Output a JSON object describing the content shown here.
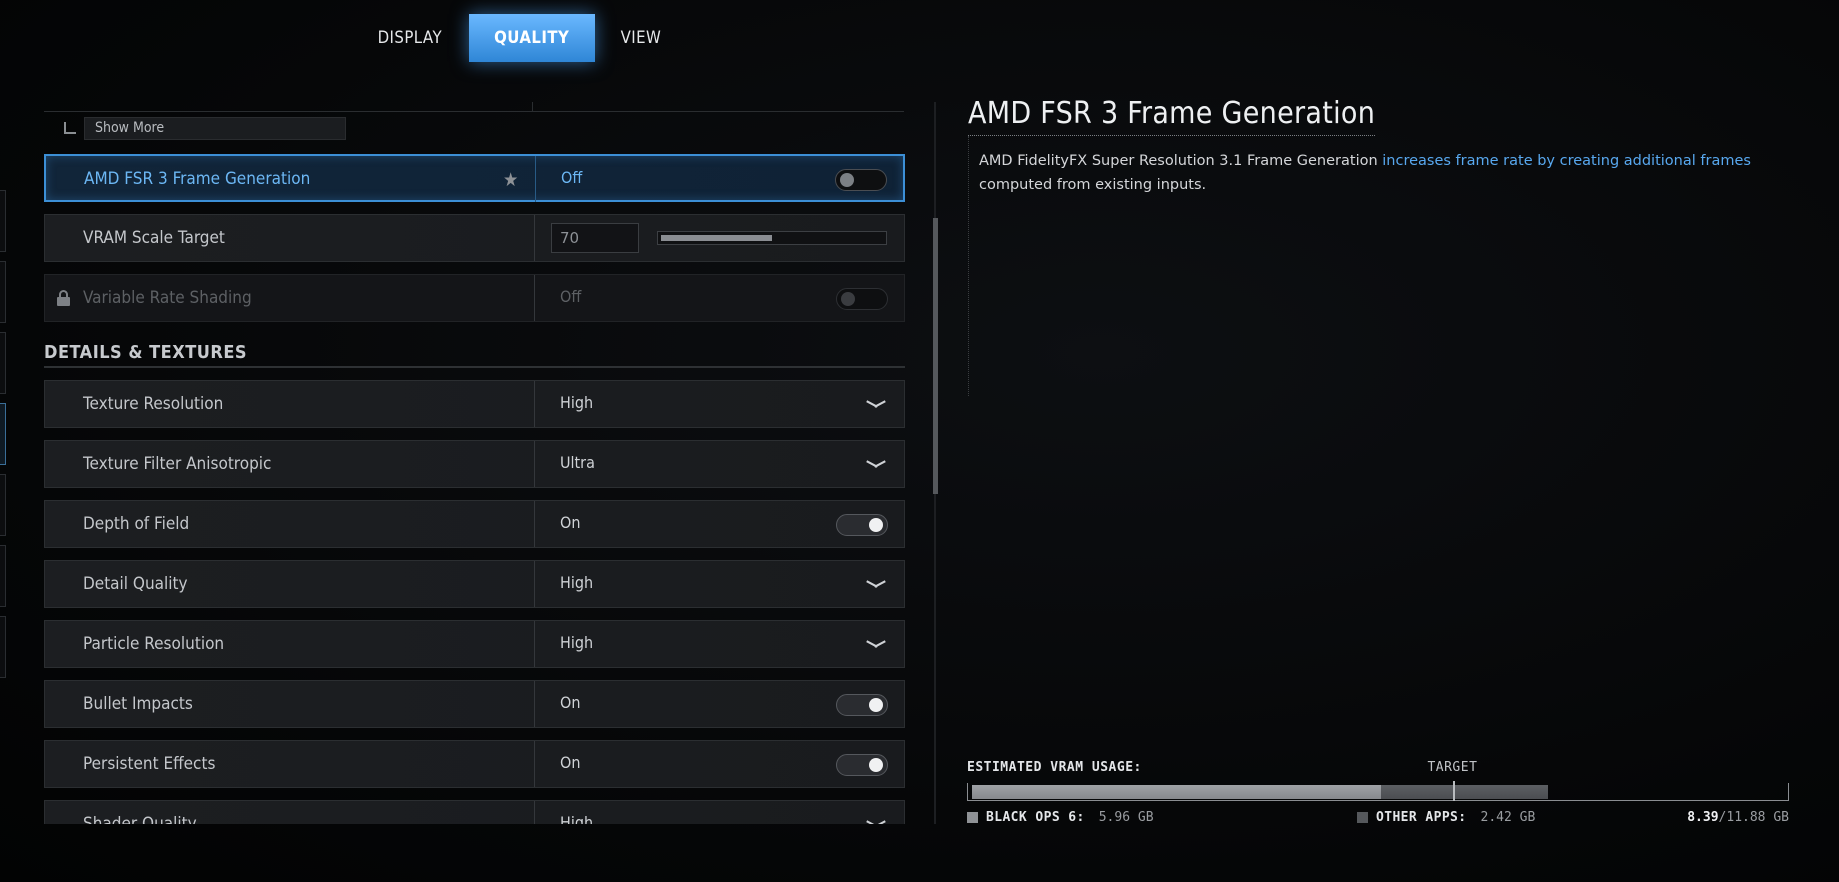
{
  "tabs": [
    {
      "label": "DISPLAY",
      "active": false
    },
    {
      "label": "QUALITY",
      "active": true
    },
    {
      "label": "VIEW",
      "active": false
    }
  ],
  "show_more_label": "Show More",
  "settings_top": [
    {
      "label": "AMD FSR 3 Frame Generation",
      "value": "Off",
      "control": "toggle",
      "state": "off",
      "favorite": true,
      "selected": true
    },
    {
      "label": "VRAM Scale Target",
      "value": "70",
      "control": "slider",
      "level_percent": 50
    },
    {
      "label": "Variable Rate Shading",
      "value": "Off",
      "control": "toggle",
      "state": "off",
      "locked": true
    }
  ],
  "section_title": "DETAILS & TEXTURES",
  "settings_details": [
    {
      "label": "Texture Resolution",
      "value": "High",
      "control": "dropdown"
    },
    {
      "label": "Texture Filter Anisotropic",
      "value": "Ultra",
      "control": "dropdown"
    },
    {
      "label": "Depth of Field",
      "value": "On",
      "control": "toggle",
      "state": "on"
    },
    {
      "label": "Detail Quality",
      "value": "High",
      "control": "dropdown"
    },
    {
      "label": "Particle Resolution",
      "value": "High",
      "control": "dropdown"
    },
    {
      "label": "Bullet Impacts",
      "value": "On",
      "control": "toggle",
      "state": "on"
    },
    {
      "label": "Persistent Effects",
      "value": "On",
      "control": "toggle",
      "state": "on"
    },
    {
      "label": "Shader Quality",
      "value": "High",
      "control": "dropdown"
    }
  ],
  "info": {
    "title": "AMD FSR 3 Frame Generation",
    "desc_before": "AMD FidelityFX Super Resolution 3.1 Frame Generation ",
    "desc_highlight": "increases frame rate by creating additional frames",
    "desc_after": " computed from existing inputs."
  },
  "vram": {
    "label": "ESTIMATED VRAM USAGE:",
    "target_label": "TARGET",
    "game_name": "BLACK OPS 6:",
    "game_amount": "5.96 GB",
    "other_name": "OTHER APPS:",
    "other_amount": "2.42 GB",
    "total_used": "8.39",
    "total_capacity": "/11.88 GB",
    "game_gb": 5.96,
    "other_gb": 2.42,
    "capacity_gb": 11.88,
    "target_fraction": 0.59
  },
  "colors": {
    "accent": "#3c8fd6",
    "highlight_text": "#58a8ef",
    "vram_game": "#9fa2a6",
    "vram_other": "#55585c"
  }
}
